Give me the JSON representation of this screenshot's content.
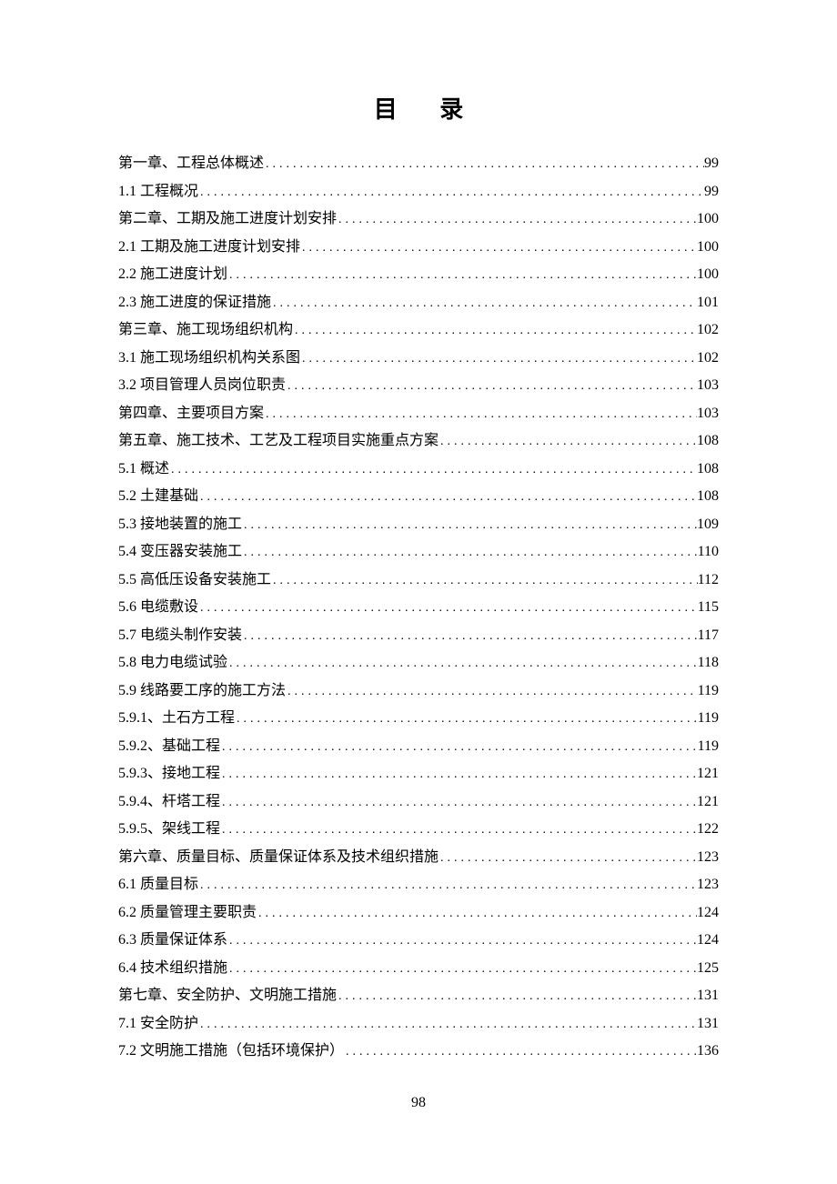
{
  "title": "目 录",
  "page_number": "98",
  "toc": [
    {
      "label": "第一章、工程总体概述",
      "page": "99"
    },
    {
      "label": "1.1 工程概况",
      "page": "99"
    },
    {
      "label": "第二章、工期及施工进度计划安排",
      "page": "100"
    },
    {
      "label": "2.1 工期及施工进度计划安排",
      "page": "100"
    },
    {
      "label": "2.2 施工进度计划",
      "page": "100"
    },
    {
      "label": "2.3 施工进度的保证措施",
      "page": "101"
    },
    {
      "label": "第三章、施工现场组织机构",
      "page": "102"
    },
    {
      "label": "3.1 施工现场组织机构关系图",
      "page": "102"
    },
    {
      "label": "3.2 项目管理人员岗位职责",
      "page": "103"
    },
    {
      "label": "第四章、主要项目方案",
      "page": "103"
    },
    {
      "label": "第五章、施工技术、工艺及工程项目实施重点方案",
      "page": "108"
    },
    {
      "label": "5.1 概述",
      "page": "108"
    },
    {
      "label": "5.2 土建基础",
      "page": "108"
    },
    {
      "label": "5.3 接地装置的施工",
      "page": "109"
    },
    {
      "label": "5.4 变压器安装施工",
      "page": "110"
    },
    {
      "label": "5.5 高低压设备安装施工",
      "page": "112"
    },
    {
      "label": "5.6 电缆敷设",
      "page": "115"
    },
    {
      "label": "5.7 电缆头制作安装",
      "page": "117"
    },
    {
      "label": "5.8 电力电缆试验",
      "page": "118"
    },
    {
      "label": "5.9 线路要工序的施工方法",
      "page": "119"
    },
    {
      "label": "5.9.1、土石方工程",
      "page": "119"
    },
    {
      "label": "5.9.2、基础工程",
      "page": "119"
    },
    {
      "label": "5.9.3、接地工程",
      "page": "121"
    },
    {
      "label": "5.9.4、杆塔工程",
      "page": "121"
    },
    {
      "label": "5.9.5、架线工程",
      "page": "122"
    },
    {
      "label": "第六章、质量目标、质量保证体系及技术组织措施",
      "page": "123"
    },
    {
      "label": "6.1 质量目标",
      "page": "123"
    },
    {
      "label": "6.2 质量管理主要职责",
      "page": "124"
    },
    {
      "label": "6.3 质量保证体系",
      "page": "124"
    },
    {
      "label": "6.4 技术组织措施",
      "page": "125"
    },
    {
      "label": "第七章、安全防护、文明施工措施",
      "page": "131"
    },
    {
      "label": "7.1 安全防护",
      "page": "131"
    },
    {
      "label": "7.2 文明施工措施（包括环境保护）",
      "page": "136"
    }
  ]
}
